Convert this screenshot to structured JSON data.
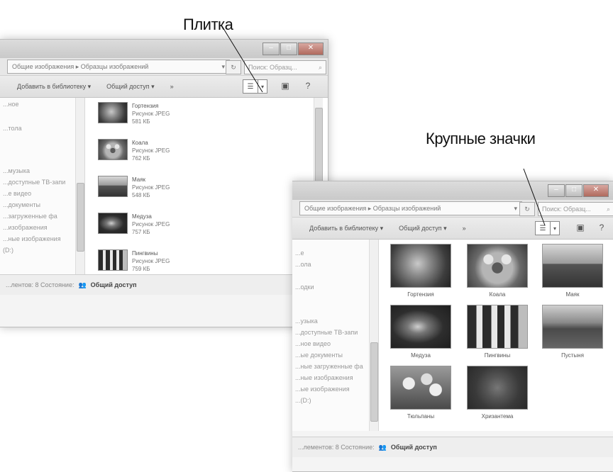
{
  "callouts": {
    "tile": "Плитка",
    "large_icons": "Крупные значки"
  },
  "window1": {
    "breadcrumb": "Общие изображения ▸ Образцы изображений",
    "search_placeholder": "Поиск: Образц...",
    "toolbar": {
      "add_to_library": "Добавить в библиотеку ▾",
      "share": "Общий доступ ▾",
      "more": "»"
    },
    "nav_items": [
      "...ное",
      "...тола",
      "...музыка",
      "...доступные ТВ-запи",
      "...е видео",
      "...документы",
      "...загруженные фа",
      "...изображения",
      "...ные изображения",
      "(D:)"
    ],
    "files": [
      {
        "name": "Гортензия",
        "type": "Рисунок JPEG",
        "size": "581 КБ",
        "icon": "hydrangea-image"
      },
      {
        "name": "Коала",
        "type": "Рисунок JPEG",
        "size": "762 КБ",
        "icon": "koala-image"
      },
      {
        "name": "Маяк",
        "type": "Рисунок JPEG",
        "size": "548 КБ",
        "icon": "lighthouse-image"
      },
      {
        "name": "Медуза",
        "type": "Рисунок JPEG",
        "size": "757 КБ",
        "icon": "jellyfish-image"
      },
      {
        "name": "Пингвины",
        "type": "Рисунок JPEG",
        "size": "759 КБ",
        "icon": "penguins-image"
      }
    ],
    "status": {
      "prefix": "...лентов: 8  Состояние:",
      "value": "Общий доступ"
    }
  },
  "window2": {
    "breadcrumb": "Общие изображения ▸ Образцы изображений",
    "search_placeholder": "Поиск: Образц...",
    "toolbar": {
      "add_to_library": "Добавить в библиотеку ▾",
      "share": "Общий доступ ▾",
      "more": "»"
    },
    "nav_items": [
      "...е",
      "...ола",
      "...одки",
      "...узыка",
      "...доступные ТВ-запи",
      "...ное видео",
      "...ые документы",
      "...ные загруженные фа",
      "...ные изображения",
      "...ые изображения",
      "...(D:)"
    ],
    "files": [
      {
        "name": "Гортензия",
        "icon": "hydrangea-image"
      },
      {
        "name": "Коала",
        "icon": "koala-image"
      },
      {
        "name": "Маяк",
        "icon": "lighthouse-image"
      },
      {
        "name": "Медуза",
        "icon": "jellyfish-image"
      },
      {
        "name": "Пингвины",
        "icon": "penguins-image"
      },
      {
        "name": "Пустыня",
        "icon": "desert-image"
      },
      {
        "name": "Тюльпаны",
        "icon": "tulips-image"
      },
      {
        "name": "Хризантема",
        "icon": "chrysanthemum-image"
      }
    ],
    "status": {
      "prefix": "...лементов: 8  Состояние:",
      "value": "Общий доступ"
    }
  }
}
